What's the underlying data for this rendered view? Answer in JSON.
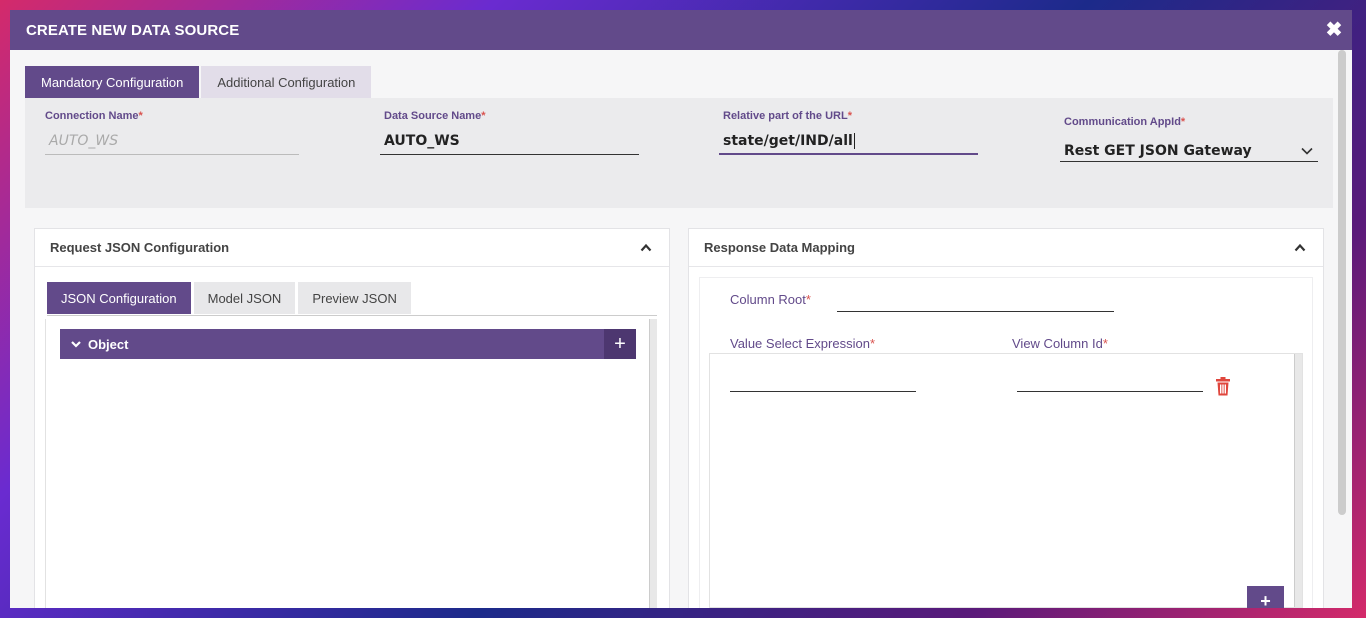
{
  "modal": {
    "title": "CREATE NEW DATA SOURCE",
    "close_label": "✖"
  },
  "tabs": [
    {
      "label": "Mandatory Configuration",
      "active": true
    },
    {
      "label": "Additional Configuration",
      "active": false
    }
  ],
  "fields": {
    "connection_name": {
      "label": "Connection Name",
      "required": "*",
      "placeholder": "AUTO_WS"
    },
    "data_source_name": {
      "label": "Data Source Name",
      "required": "*",
      "value": "AUTO_WS"
    },
    "relative_url": {
      "label": "Relative part of the URL",
      "required": "*",
      "value": "state/get/IND/all"
    },
    "communication_appid": {
      "label": "Communication AppId",
      "required": "*",
      "value": "Rest GET JSON Gateway"
    }
  },
  "request_panel": {
    "title": "Request JSON Configuration",
    "subtabs": [
      {
        "label": "JSON Configuration",
        "active": true
      },
      {
        "label": "Model JSON",
        "active": false
      },
      {
        "label": "Preview JSON",
        "active": false
      }
    ],
    "object_label": "Object",
    "object_add_label": "+"
  },
  "response_panel": {
    "title": "Response Data Mapping",
    "column_root_label": "Column Root",
    "value_select_label": "Value Select Expression",
    "view_column_label": "View Column Id",
    "required": "*",
    "add_label": "+"
  },
  "colors": {
    "accent": "#624a8a",
    "required": "#d9534f",
    "delete": "#e0473e"
  },
  "icons": {
    "close": "close-icon",
    "collapse": "chevron-up-icon",
    "expand": "chevron-down-icon",
    "delete": "trash-icon",
    "dropdown": "chevron-down-icon"
  }
}
